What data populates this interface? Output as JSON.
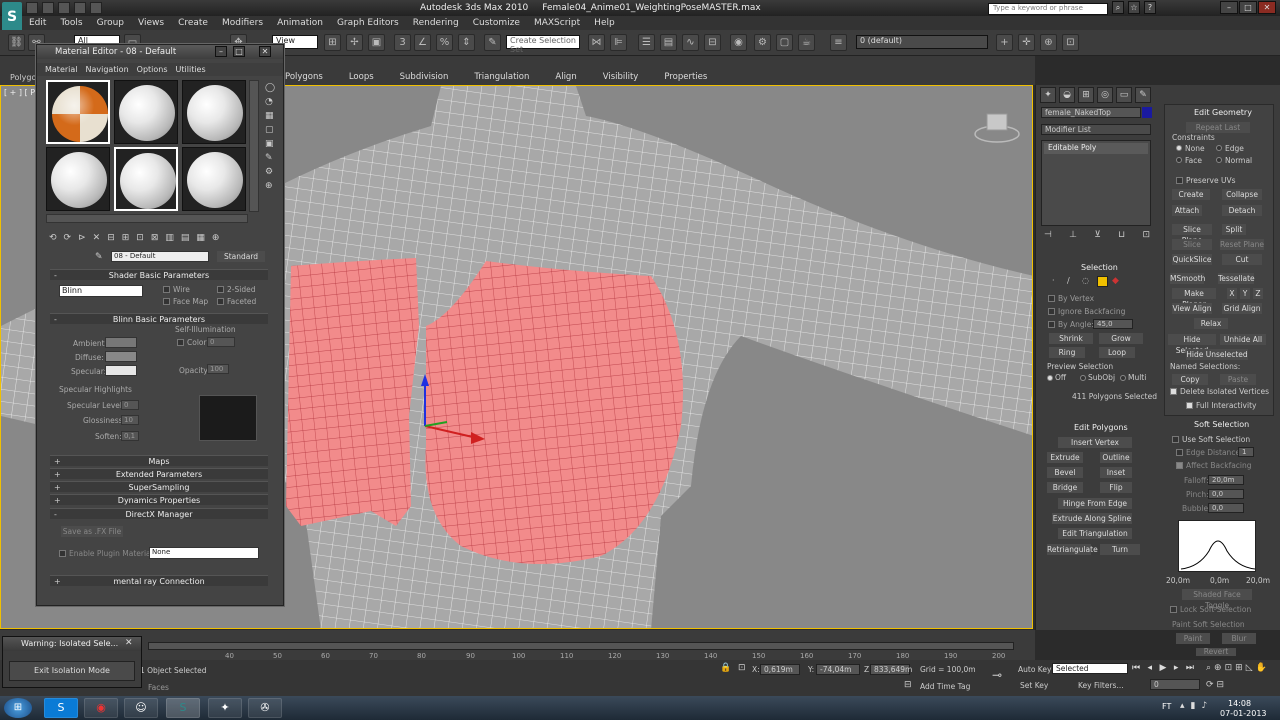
{
  "app": {
    "icon_letter": "S",
    "title_app": "Autodesk 3ds Max 2010",
    "title_file": "Female04_Anime01_WeightingPoseMASTER.max",
    "search_placeholder": "Type a keyword or phrase"
  },
  "menubar": [
    "Edit",
    "Tools",
    "Group",
    "Views",
    "Create",
    "Modifiers",
    "Animation",
    "Graph Editors",
    "Rendering",
    "Customize",
    "MAXScript",
    "Help"
  ],
  "toolbar": {
    "selection_filter": "All",
    "view_dropdown": "View",
    "named_sel_dropdown": "Create Selection Set",
    "layer_dropdown": "0 (default)"
  },
  "ribbon": {
    "mode_label": "Polygon Modeling",
    "tabs": [
      "Polygons",
      "Loops",
      "Subdivision",
      "Triangulation",
      "Align",
      "Visibility",
      "Properties"
    ]
  },
  "viewport": {
    "label": "[ + ] [ Perspective ] [ Realistic + Edged Faces ]",
    "accent": "#f0c000",
    "selection_color": "#f28b8b"
  },
  "material_editor": {
    "title": "Material Editor - 08 - Default",
    "menu": [
      "Material",
      "Navigation",
      "Options",
      "Utilities"
    ],
    "material_name": "08 - Default",
    "material_type": "Standard",
    "shader_rollout": "Shader Basic Parameters",
    "shader": "Blinn",
    "shader_opts": [
      "Wire",
      "2-Sided",
      "Face Map",
      "Faceted"
    ],
    "blinn_rollout": "Blinn Basic Parameters",
    "self_illum": "Self-Illumination",
    "color_label": "Color",
    "color_value": "0",
    "ambient": "Ambient:",
    "diffuse": "Diffuse:",
    "specular": "Specular:",
    "opacity_label": "Opacity:",
    "opacity_value": "100",
    "spec_highlights": "Specular Highlights",
    "spec_level_label": "Specular Level:",
    "spec_level_value": "0",
    "glossiness_label": "Glossiness:",
    "glossiness_value": "10",
    "soften_label": "Soften:",
    "soften_value": "0,1",
    "rollouts": [
      "Maps",
      "Extended Parameters",
      "SuperSampling",
      "Dynamics Properties"
    ],
    "directx_rollout": "DirectX Manager",
    "save_fx": "Save as .FX File",
    "enable_plugin": "Enable Plugin Material",
    "plugin_value": "None",
    "mental_ray": "mental ray Connection"
  },
  "command_panel": {
    "object_name": "female_NakedTop",
    "modifier_list": "Modifier List",
    "stack_item": "Editable Poly",
    "selection_head": "Selection",
    "by_vertex": "By Vertex",
    "ignore_backfacing": "Ignore Backfacing",
    "by_angle": "By Angle:",
    "by_angle_value": "45,0",
    "shrink": "Shrink",
    "grow": "Grow",
    "ring": "Ring",
    "loop": "Loop",
    "preview_selection": "Preview Selection",
    "preview_opts": [
      "Off",
      "SubObj",
      "Multi"
    ],
    "polys_selected": "411 Polygons Selected",
    "edit_polygons_head": "Edit Polygons",
    "insert_vertex": "Insert Vertex",
    "extrude": "Extrude",
    "outline": "Outline",
    "bevel": "Bevel",
    "inset": "Inset",
    "bridge": "Bridge",
    "flip": "Flip",
    "hinge": "Hinge From Edge",
    "extrude_spline": "Extrude Along Spline",
    "edit_tri": "Edit Triangulation",
    "retriangulate": "Retriangulate",
    "turn": "Turn",
    "edit_geom_head": "Edit Geometry",
    "repeat_last": "Repeat Last",
    "constraints": "Constraints",
    "constraint_opts": [
      "None",
      "Edge",
      "Face",
      "Normal"
    ],
    "preserve_uvs": "Preserve UVs",
    "create": "Create",
    "collapse": "Collapse",
    "attach": "Attach",
    "detach": "Detach",
    "slice_plane": "Slice Plane",
    "split": "Split",
    "slice": "Slice",
    "reset_plane": "Reset Plane",
    "quickslice": "QuickSlice",
    "cut": "Cut",
    "msmooth": "MSmooth",
    "tessellate": "Tessellate",
    "make_planar": "Make Planar",
    "xyz": [
      "X",
      "Y",
      "Z"
    ],
    "view_align": "View Align",
    "grid_align": "Grid Align",
    "relax": "Relax",
    "hide_selected": "Hide Selected",
    "unhide_all": "Unhide All",
    "hide_unselected": "Hide Unselected",
    "named_selections": "Named Selections:",
    "copy": "Copy",
    "paste": "Paste",
    "delete_isolated": "Delete Isolated Vertices",
    "full_interactivity": "Full Interactivity",
    "soft_sel_head": "Soft Selection",
    "use_soft": "Use Soft Selection",
    "edge_distance": "Edge Distance:",
    "edge_distance_value": "1",
    "affect_backfacing": "Affect Backfacing",
    "falloff": "Falloff:",
    "falloff_value": "20,0m",
    "pinch": "Pinch:",
    "pinch_value": "0,0",
    "bubble": "Bubble:",
    "bubble_value": "0,0",
    "curve_labels": [
      "20,0m",
      "0,0m",
      "20,0m"
    ],
    "shaded_face": "Shaded Face Toggle",
    "lock_soft": "Lock Soft Selection",
    "paint_soft": "Paint Soft Selection",
    "paint": "Paint",
    "blur": "Blur",
    "revert": "Revert"
  },
  "timeline": {
    "ticks": [
      "40",
      "50",
      "60",
      "70",
      "80",
      "90",
      "100",
      "110",
      "120",
      "130",
      "140",
      "150",
      "160",
      "170",
      "180",
      "190",
      "200"
    ]
  },
  "status": {
    "warning_title": "Warning: Isolated Sele...",
    "exit_isolation": "Exit Isolation Mode",
    "object_selected": "1 Object Selected",
    "faces_hint": "Faces",
    "x_label": "X:",
    "x_value": "0,619m",
    "y_label": "Y:",
    "y_value": "-74,04m",
    "z_label": "Z:",
    "z_value": "833,649m",
    "grid": "Grid = 100,0m",
    "add_time_tag": "Add Time Tag",
    "auto_key": "Auto Key",
    "set_key": "Set Key",
    "key_mode": "Selected",
    "key_filters": "Key Filters...",
    "frame": "0"
  },
  "taskbar": {
    "lang": "FT",
    "time": "14:08",
    "date": "07-01-2013"
  }
}
